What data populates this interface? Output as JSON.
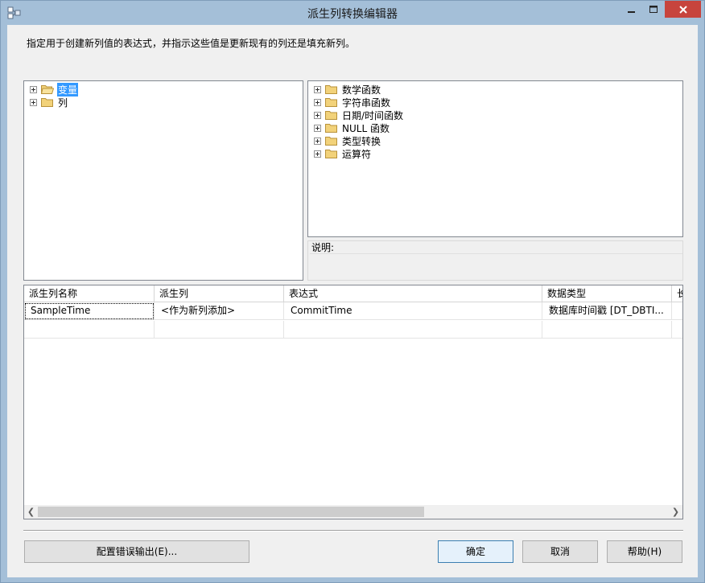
{
  "window": {
    "title": "派生列转换编辑器",
    "icon": "ssis-transform-icon"
  },
  "instruction": "指定用于创建新列值的表达式，并指示这些值是更新现有的列还是填充新列。",
  "left_tree": [
    {
      "label": "变量",
      "selected": true,
      "icon": "folder-open-icon"
    },
    {
      "label": "列",
      "selected": false,
      "icon": "folder-icon"
    }
  ],
  "right_tree": [
    {
      "label": "数学函数",
      "icon": "folder-icon"
    },
    {
      "label": "字符串函数",
      "icon": "folder-icon"
    },
    {
      "label": "日期/时间函数",
      "icon": "folder-icon"
    },
    {
      "label": "NULL 函数",
      "icon": "folder-icon"
    },
    {
      "label": "类型转换",
      "icon": "folder-icon"
    },
    {
      "label": "运算符",
      "icon": "folder-icon"
    }
  ],
  "description": {
    "label": "说明:",
    "text": ""
  },
  "grid": {
    "columns": [
      "派生列名称",
      "派生列",
      "表达式",
      "数据类型",
      "长"
    ],
    "rows": [
      [
        "SampleTime",
        "<作为新列添加>",
        "CommitTime",
        "数据库时间戳 [DT_DBTI...",
        ""
      ]
    ]
  },
  "buttons": {
    "error_output": "配置错误输出(E)...",
    "ok": "确定",
    "cancel": "取消",
    "help": "帮助(H)"
  },
  "colors": {
    "title_bar": "#a4bfd8",
    "close_button": "#c7443d",
    "selection": "#3399ff",
    "folder": "#e8c15a"
  }
}
